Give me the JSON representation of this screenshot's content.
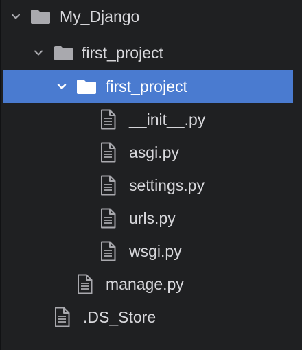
{
  "tree": {
    "items": [
      {
        "label": "My_Django",
        "type": "folder",
        "expanded": true,
        "selected": false,
        "depth": 0,
        "icon": "folder-icon",
        "chevron": "chevron-down-icon"
      },
      {
        "label": "first_project",
        "type": "folder",
        "expanded": true,
        "selected": false,
        "depth": 1,
        "icon": "folder-icon",
        "chevron": "chevron-down-icon"
      },
      {
        "label": "first_project",
        "type": "folder",
        "expanded": true,
        "selected": true,
        "depth": 2,
        "icon": "folder-icon",
        "chevron": "chevron-down-icon"
      },
      {
        "label": "__init__.py",
        "type": "file",
        "selected": false,
        "depth": 3,
        "icon": "file-icon"
      },
      {
        "label": "asgi.py",
        "type": "file",
        "selected": false,
        "depth": 3,
        "icon": "file-icon"
      },
      {
        "label": "settings.py",
        "type": "file",
        "selected": false,
        "depth": 3,
        "icon": "file-icon"
      },
      {
        "label": "urls.py",
        "type": "file",
        "selected": false,
        "depth": 3,
        "icon": "file-icon"
      },
      {
        "label": "wsgi.py",
        "type": "file",
        "selected": false,
        "depth": 3,
        "icon": "file-icon"
      },
      {
        "label": "manage.py",
        "type": "file",
        "selected": false,
        "depth": 2,
        "icon": "file-icon"
      },
      {
        "label": ".DS_Store",
        "type": "file",
        "selected": false,
        "depth": 1,
        "icon": "file-icon"
      }
    ]
  },
  "colors": {
    "background": "#1f2022",
    "selection": "#4a7bd0",
    "text": "#d8d8dc",
    "icon": "#a9a9ae",
    "selected_text": "#ffffff"
  }
}
